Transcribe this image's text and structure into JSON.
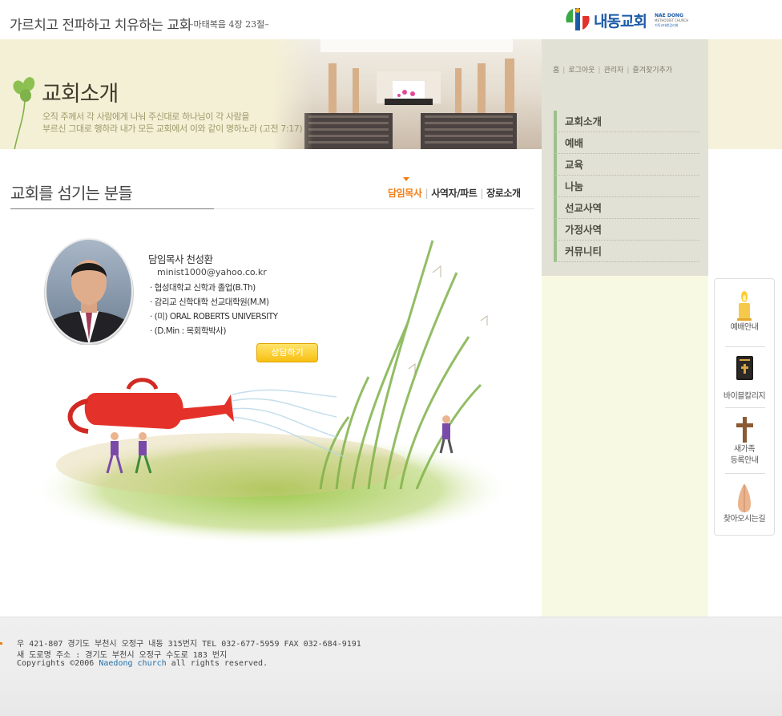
{
  "header": {
    "slogan": "가르치고 전파하고 치유하는 교회",
    "verse": "–마태복음 4장 23절–",
    "logo": {
      "korean": "내동교회",
      "english_1": "NAE DONG",
      "english_2": "METHODIST CHURCH",
      "english_3": "기독교대한감리회"
    }
  },
  "banner": {
    "title": "교회소개",
    "verse_line_1": "오직 주께서 각 사람에게 나눠 주신대로 하나님이 각 사람을",
    "verse_line_2": "부르신 그대로 행하라 내가 모든 교회에서 이와 같이 명하노라 (고전 7:17)"
  },
  "util_nav": {
    "home": "홈",
    "logout": "로그아웃",
    "admin": "관리자",
    "bookmark": "즐겨찾기추가"
  },
  "side_menu": {
    "items": [
      {
        "label": "교회소개"
      },
      {
        "label": "예배"
      },
      {
        "label": "교육"
      },
      {
        "label": "나눔"
      },
      {
        "label": "선교사역"
      },
      {
        "label": "가정사역"
      },
      {
        "label": "커뮤니티"
      }
    ]
  },
  "quick_links": {
    "worship": "예배안내",
    "bible": "바이블칼리지",
    "newfamily_1": "새가족",
    "newfamily_2": "등록안내",
    "directions": "찾아오시는길",
    "icons": [
      "candle-icon",
      "bible-icon",
      "cross-icon",
      "praying-hands-icon"
    ]
  },
  "main": {
    "page_title": "교회를 섬기는 분들",
    "tabs": [
      {
        "label": "담임목사",
        "active": true
      },
      {
        "label": "사역자/파트",
        "active": false
      },
      {
        "label": "장로소개",
        "active": false
      }
    ],
    "pastor": {
      "name": "담임목사 천성환",
      "email": "minist1000@yahoo.co.kr",
      "credentials": [
        "· 협성대학교 신학과 졸업(B.Th)",
        "· 감리교 신학대학 선교대학원(M.M)",
        "· (미) ORAL ROBERTS UNIVERSITY",
        "· (D.Min : 목회학박사)"
      ],
      "consult_button": "상담하기"
    }
  },
  "footer": {
    "line_1": "우 421-807  경기도 부천시 오정구 내동 315번지 TEL 032-677-5959  FAX 032-684-9191",
    "line_2": "새 도로명 주소 : 경기도 부천시 오정구 수도로 183 번지",
    "line_3_prefix": "Copyrights ©2006 ",
    "line_3_brand": "Naedong church",
    "line_3_suffix": " all rights reserved."
  },
  "colors": {
    "accent": "#f07e16",
    "brand_blue": "#1b5aa7",
    "menu_bar": "#9ec08c",
    "button": "#f7bf12"
  }
}
